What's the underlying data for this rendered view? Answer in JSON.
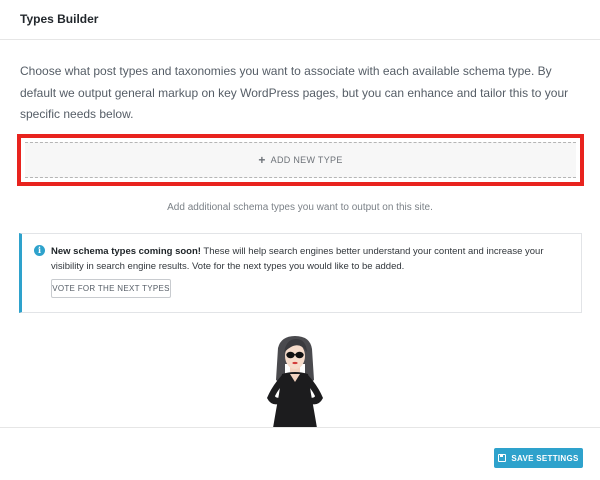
{
  "header": {
    "title": "Types Builder"
  },
  "intro": {
    "text": "Choose what post types and taxonomies you want to associate with each available schema type. By default we output general markup on key WordPress pages, but you can enhance and tailor this to your specific needs below."
  },
  "add_type": {
    "icon": "plus-icon",
    "label": "ADD NEW TYPE"
  },
  "helper": {
    "text": "Add additional schema types you want to output on this site."
  },
  "notice": {
    "icon": "info-icon",
    "bold": "New schema types coming soon!",
    "text": " These will help search engines better understand your content and increase your visibility in search engine results. Vote for the next types you would like to be added.",
    "button_label": "VOTE FOR THE NEXT TYPES"
  },
  "footer": {
    "save_label": "SAVE SETTINGS",
    "save_icon": "floppy-disk-icon"
  },
  "colors": {
    "accent": "#2ea2cc",
    "highlight": "#e8231e"
  }
}
